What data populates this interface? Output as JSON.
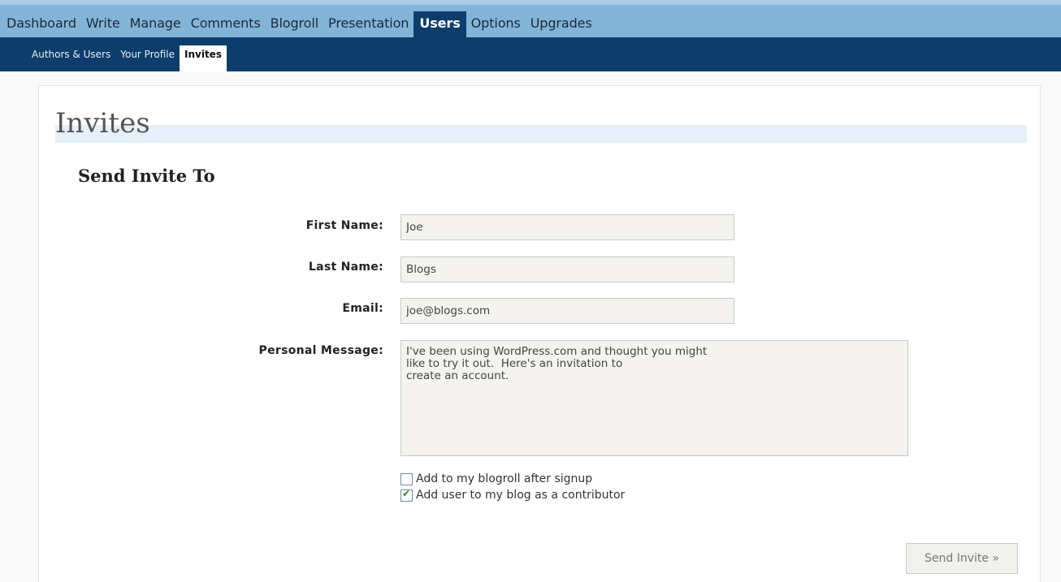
{
  "topnav": {
    "items": [
      "Dashboard",
      "Write",
      "Manage",
      "Comments",
      "Blogroll",
      "Presentation",
      "Users",
      "Options",
      "Upgrades"
    ],
    "active": "Users"
  },
  "subnav": {
    "items": [
      "Authors & Users",
      "Your Profile",
      "Invites"
    ],
    "active": "Invites"
  },
  "page": {
    "title": "Invites",
    "section_title": "Send Invite To"
  },
  "form": {
    "first_name_label": "First Name:",
    "first_name_value": "Joe",
    "last_name_label": "Last Name:",
    "last_name_value": "Blogs",
    "email_label": "Email:",
    "email_value": "joe@blogs.com",
    "message_label": "Personal Message:",
    "message_value": "I've been using WordPress.com and thought you might\nlike to try it out.  Here's an invitation to\ncreate an account.",
    "blogroll_label": "Add to my blogroll after signup",
    "blogroll_checked": false,
    "contributor_label": "Add user to my blog as a contributor",
    "contributor_checked": true,
    "submit_label": "Send Invite »"
  },
  "colors": {
    "topnav_bg": "#83b4d8",
    "subnav_bg": "#0d3d6b",
    "active_tab": "#0d3d6b"
  }
}
